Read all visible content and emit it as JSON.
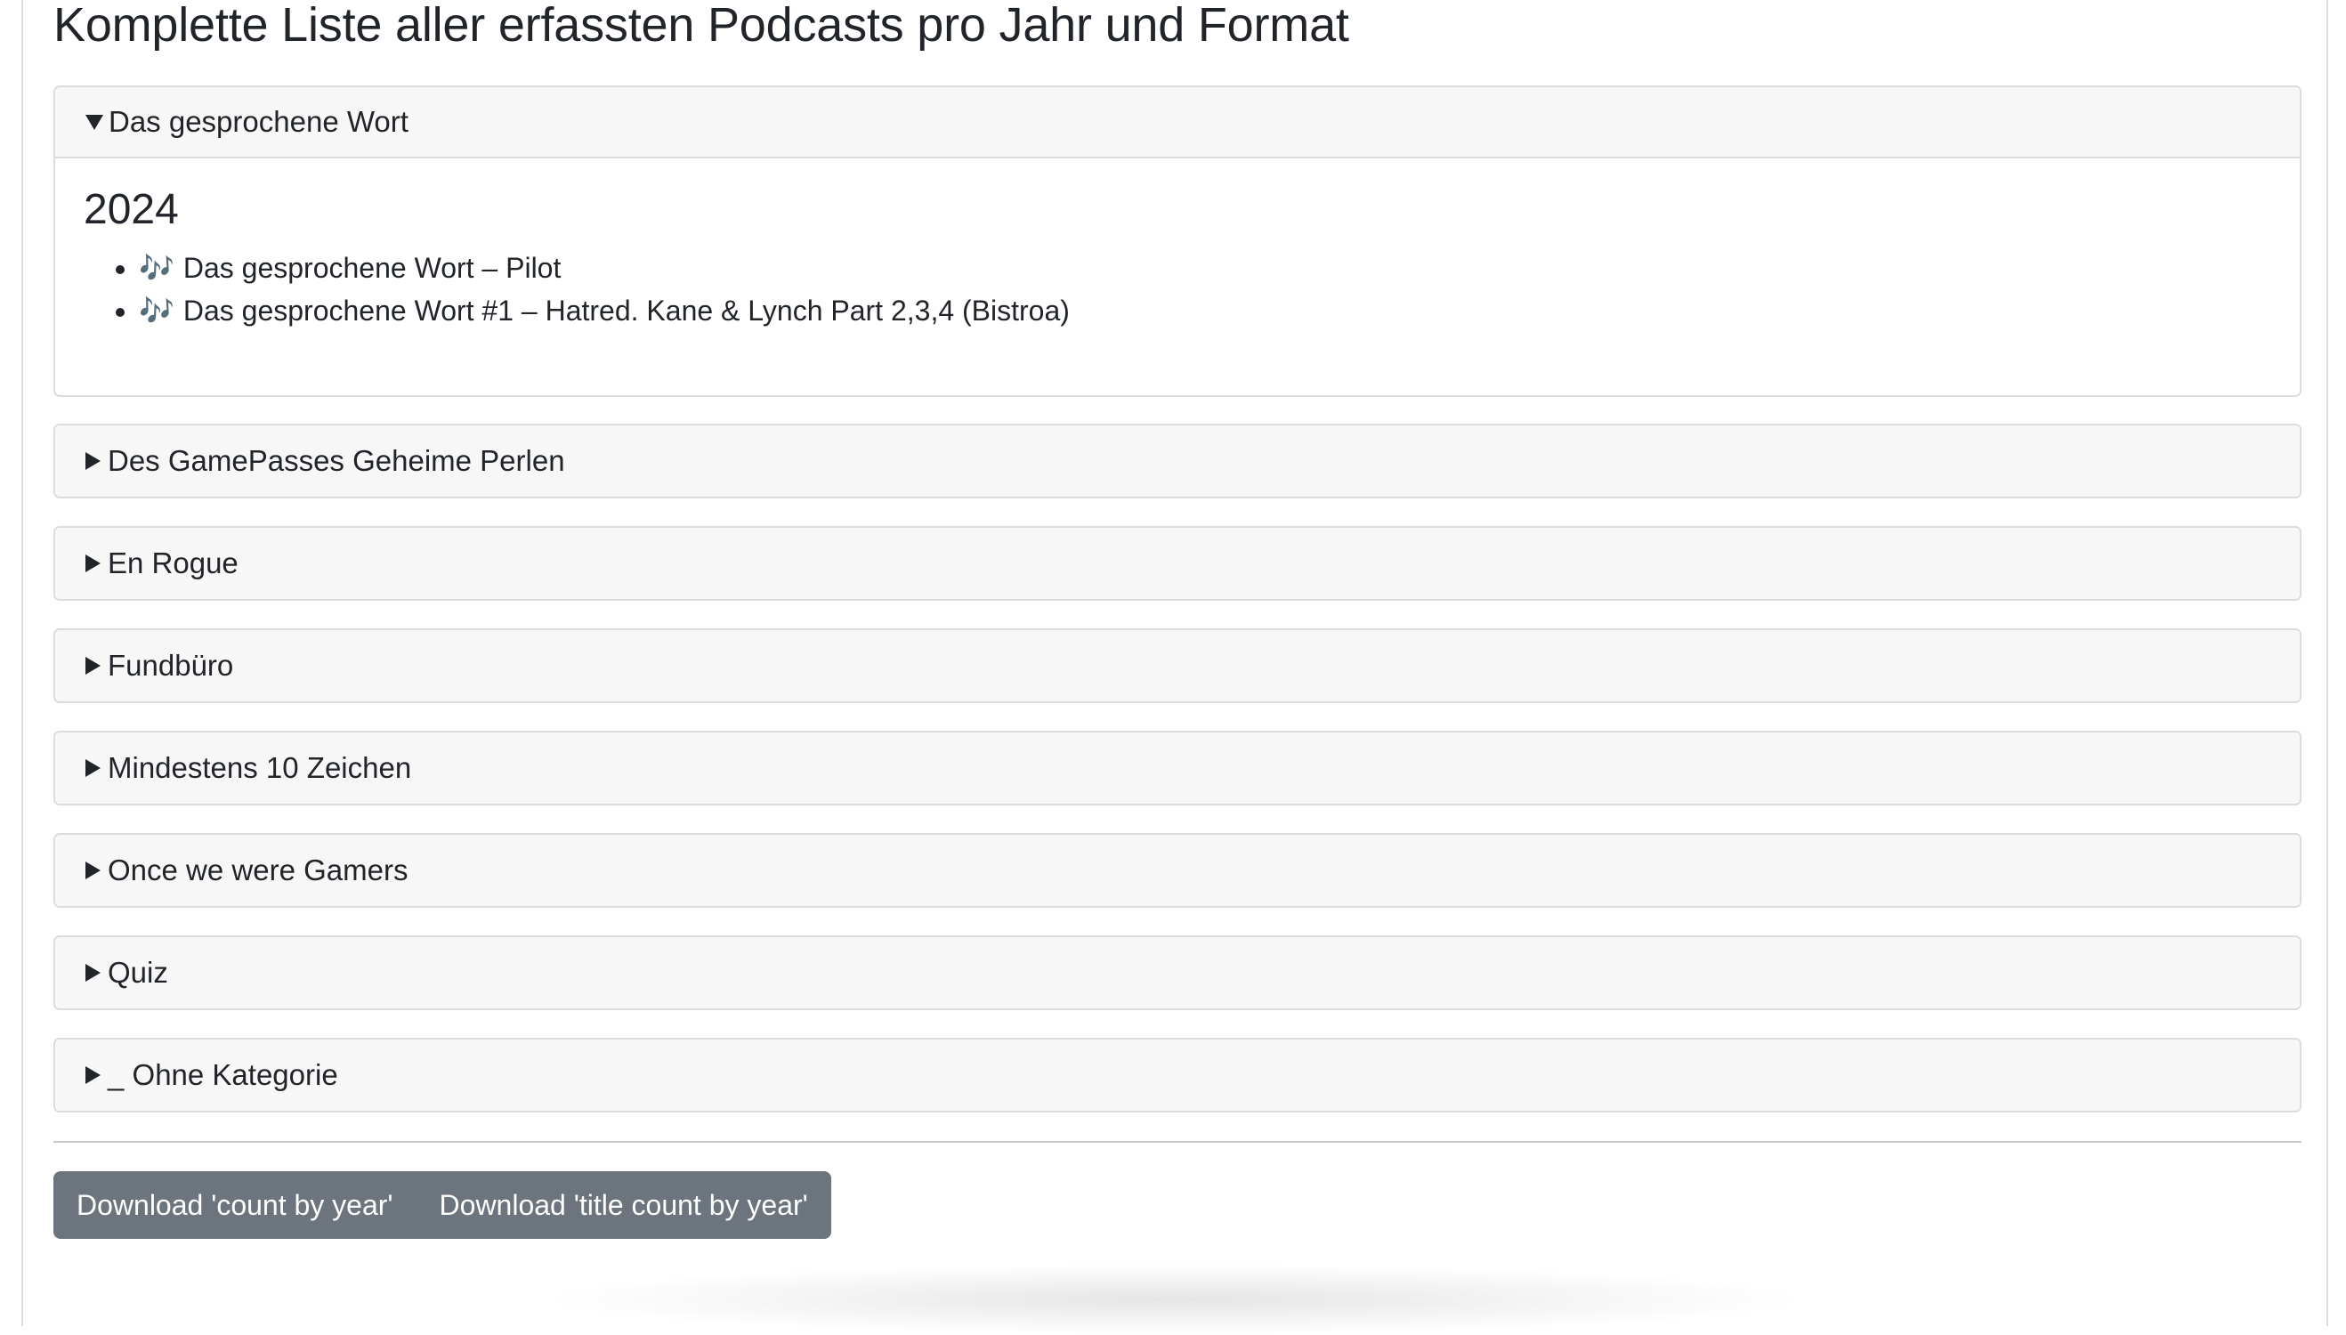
{
  "page": {
    "title": "Komplette Liste aller erfassten Podcasts pro Jahr und Format"
  },
  "categories": [
    {
      "name": "Das gesprochene Wort",
      "expanded": true,
      "years": [
        {
          "year": "2024",
          "episodes": [
            {
              "icon": "🎶",
              "title": "Das gesprochene Wort – Pilot"
            },
            {
              "icon": "🎶",
              "title": "Das gesprochene Wort #1 – Hatred. Kane & Lynch Part 2,3,4 (Bistroa)"
            }
          ]
        }
      ]
    },
    {
      "name": "Des GamePasses Geheime Perlen",
      "expanded": false
    },
    {
      "name": "En Rogue",
      "expanded": false
    },
    {
      "name": "Fundbüro",
      "expanded": false
    },
    {
      "name": "Mindestens 10 Zeichen",
      "expanded": false
    },
    {
      "name": "Once we were Gamers",
      "expanded": false
    },
    {
      "name": "Quiz",
      "expanded": false
    },
    {
      "name": "_ Ohne Kategorie",
      "expanded": false
    }
  ],
  "downloads": {
    "count_by_year": "Download 'count by year'",
    "title_count_by_year": "Download 'title count by year'"
  },
  "colors": {
    "summary_bg": "#f7f7f7",
    "border": "#dcdcdc",
    "button_bg": "#6c757d",
    "button_text": "#ffffff",
    "text": "#212529"
  },
  "icons": {
    "expanded": "triangle-down-icon",
    "collapsed": "triangle-right-icon",
    "episode": "music-notes-icon"
  }
}
